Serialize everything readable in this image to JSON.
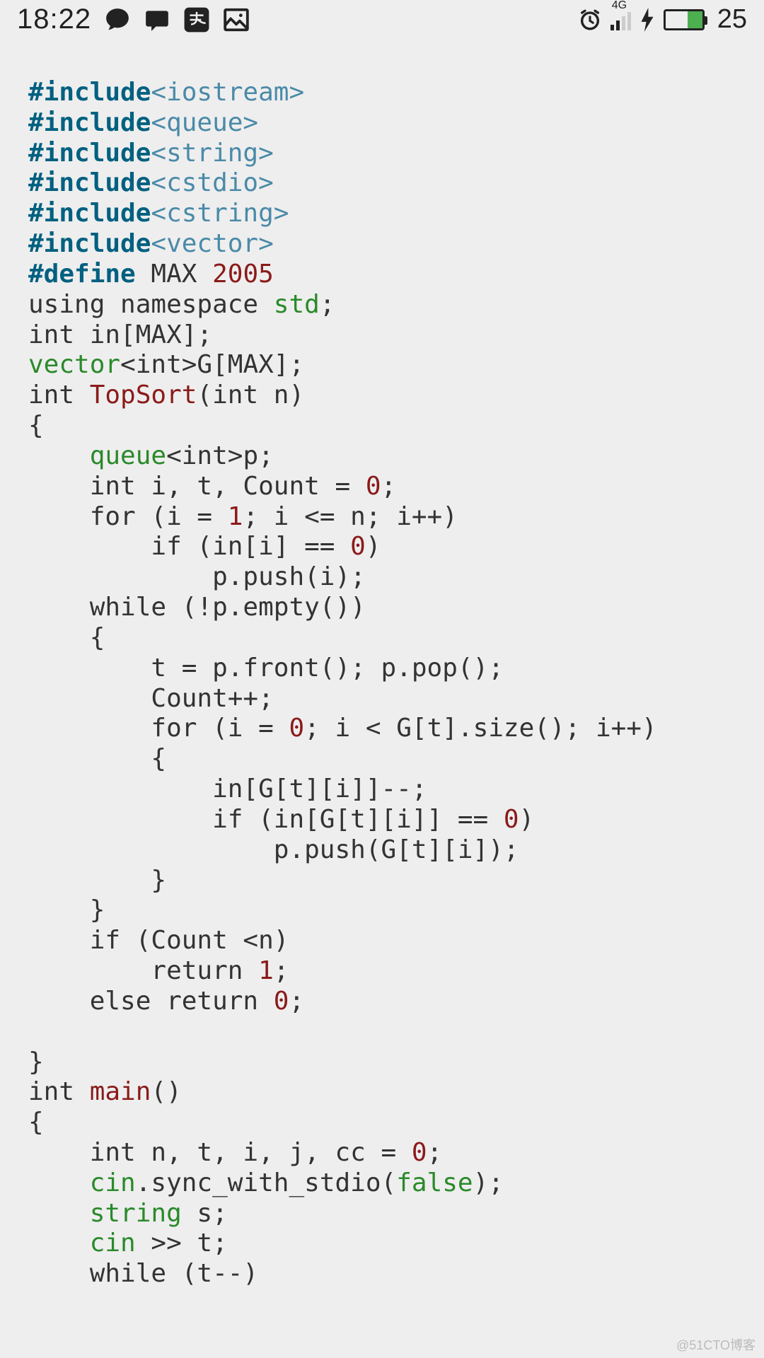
{
  "status": {
    "time": "18:22",
    "battery_pct": "25",
    "net_label": "4G"
  },
  "code": {
    "l1a": "#include",
    "l1b": "<iostream>",
    "l2a": "#include",
    "l2b": "<queue>",
    "l3a": "#include",
    "l3b": "<string>",
    "l4a": "#include",
    "l4b": "<cstdio>",
    "l5a": "#include",
    "l5b": "<cstring>",
    "l6a": "#include",
    "l6b": "<vector>",
    "l7a": "#define",
    "l7b": " MAX ",
    "l7c": "2005",
    "l8a": "using namespace ",
    "l8b": "std",
    "l8c": ";",
    "l9": "int in[MAX];",
    "l10a": "vector",
    "l10b": "<int>G[MAX];",
    "l11a": "int ",
    "l11b": "TopSort",
    "l11c": "(int n)",
    "l12": "{",
    "l13a": "    ",
    "l13b": "queue",
    "l13c": "<int>p;",
    "l14a": "    int i, t, Count = ",
    "l14b": "0",
    "l14c": ";",
    "l15a": "    for (i = ",
    "l15b": "1",
    "l15c": "; i <= n; i++)",
    "l16a": "        if (in[i] == ",
    "l16b": "0",
    "l16c": ")",
    "l17": "            p.push(i);",
    "l18": "    while (!p.empty())",
    "l19": "    {",
    "l20": "        t = p.front(); p.pop();",
    "l21": "        Count++;",
    "l22a": "        for (i = ",
    "l22b": "0",
    "l22c": "; i < G[t].size(); i++)",
    "l23": "        {",
    "l24": "            in[G[t][i]]--;",
    "l25a": "            if (in[G[t][i]] == ",
    "l25b": "0",
    "l25c": ")",
    "l26": "                p.push(G[t][i]);",
    "l27": "        }",
    "l28": "    }",
    "l29": "    if (Count <n)",
    "l30a": "        return ",
    "l30b": "1",
    "l30c": ";",
    "l31a": "    else return ",
    "l31b": "0",
    "l31c": ";",
    "l32": "",
    "l33": "}",
    "l34a": "int ",
    "l34b": "main",
    "l34c": "()",
    "l35": "{",
    "l36a": "    int n, t, i, j, cc = ",
    "l36b": "0",
    "l36c": ";",
    "l37a": "    ",
    "l37b": "cin",
    "l37c": ".sync_with_stdio(",
    "l37d": "false",
    "l37e": ");",
    "l38a": "    ",
    "l38b": "string",
    "l38c": " s;",
    "l39a": "    ",
    "l39b": "cin",
    "l39c": " >> t;",
    "l40": "    while (t--)"
  },
  "watermark": "@51CTO博客"
}
